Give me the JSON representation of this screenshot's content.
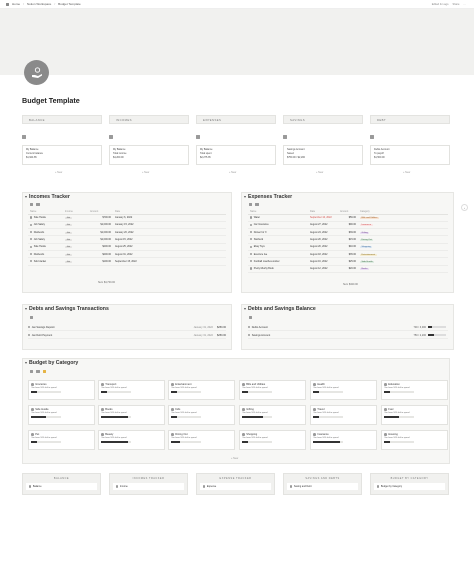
{
  "breadcrumb": [
    "Home",
    "Notion Workspace",
    "Budget Template"
  ],
  "topbar": {
    "edited": "Edited 4m ago",
    "share": "Share"
  },
  "page": {
    "title": "Budget Template"
  },
  "categories": [
    {
      "label": "BALANCE",
      "card": {
        "name": "My Balance",
        "line2": "Current balance",
        "line3": "$1,924.65"
      }
    },
    {
      "label": "INCOMES",
      "card": {
        "name": "My Balance",
        "line2": "Total income",
        "line3": "$4,200.00"
      }
    },
    {
      "label": "EXPENSES",
      "card": {
        "name": "My Balance",
        "line2": "Total spent",
        "line3": "$2,275.35"
      }
    },
    {
      "label": "SAVINGS",
      "card": {
        "name": "Savings Account",
        "line2": "Saved",
        "line3": "$750.00 / $2,200"
      }
    },
    {
      "label": "DEBT",
      "card": {
        "name": "Debts Account",
        "line2": "To payoff",
        "line3": "$1,500.00"
      }
    }
  ],
  "new_label": "+ New",
  "incomes": {
    "title": "Incomes Tracker",
    "headers": [
      "Name",
      "Income",
      "Amount",
      "Date"
    ],
    "rows": [
      {
        "name": "Side Hustle",
        "type": "Job",
        "amount": "$700.00",
        "date": "January 6, 2022"
      },
      {
        "name": "Job Salary",
        "type": "Job",
        "amount": "$1,000.00",
        "date": "January 15, 2022"
      },
      {
        "name": "Dividends",
        "type": "Job",
        "amount": "$1,000.00",
        "date": "January 20, 2022"
      },
      {
        "name": "Job Salary",
        "type": "Job",
        "amount": "$1,000.00",
        "date": "August 15, 2022"
      },
      {
        "name": "Side Hustle",
        "type": "Job",
        "amount": "$200.00",
        "date": "August 25, 2022"
      },
      {
        "name": "Dividends",
        "type": "Job",
        "amount": "$200.00",
        "date": "August 31, 2022"
      },
      {
        "name": "Sold Jacket",
        "type": "Job",
        "amount": "$100.00",
        "date": "September 15, 2022"
      }
    ],
    "sum": "Sum $4,700.00"
  },
  "expenses": {
    "title": "Expenses Tracker",
    "headers": [
      "Name",
      "Date",
      "Amount",
      "Category"
    ],
    "rows": [
      {
        "name": "Water",
        "date": "September 10, 2022",
        "amount": "$56.00",
        "category": "Bills and Utilities",
        "red": true
      },
      {
        "name": "Car Insurance",
        "date": "August 27, 2022",
        "amount": "$90.00",
        "category": "Insurance"
      },
      {
        "name": "Flower for X",
        "date": "August 24, 2022",
        "amount": "$39.00",
        "category": "Gifting"
      },
      {
        "name": "Starbuck",
        "date": "August 20, 2022",
        "amount": "$15.00",
        "category": "Dining Out"
      },
      {
        "name": "Ebay Toys",
        "date": "August 20, 2022",
        "amount": "$40.00",
        "category": "Shopping"
      },
      {
        "name": "Eventure fee",
        "date": "August 18, 2022",
        "amount": "$35.00",
        "category": "Entertainment"
      },
      {
        "name": "Football coaches worker",
        "date": "August 16, 2022",
        "amount": "$25.00",
        "category": "Side Hustle"
      },
      {
        "name": "Pretty Mushy Book",
        "date": "August 12, 2022",
        "amount": "$20.00",
        "category": "Books"
      }
    ],
    "sum": "Sum $320.00"
  },
  "debts_transactions": {
    "title": "Debts and Savings Transactions",
    "rows": [
      {
        "name": "Jan Savings Deposit",
        "date": "January 31, 2022",
        "amount": "$250.00"
      },
      {
        "name": "Jan Debt Payment",
        "date": "January 31, 2022",
        "amount": "$250.00"
      }
    ]
  },
  "debts_balance": {
    "title": "Debts and Savings Balance",
    "rows": [
      {
        "name": "Debts Account",
        "value": "700 / 3,000",
        "pct": 0.23
      },
      {
        "name": "Savings Account",
        "value": "750 / 2,200",
        "pct": 0.34
      }
    ]
  },
  "budget": {
    "title": "Budget by Category",
    "cards": [
      {
        "name": "Groceries",
        "sub": "You have 10% left to spend",
        "pct": 0.2
      },
      {
        "name": "Transport",
        "sub": "You have 10% left to spend",
        "pct": 0.2
      },
      {
        "name": "Entertainment",
        "sub": "You have 10% left to spend",
        "pct": 0.2
      },
      {
        "name": "Bills and Utilities",
        "sub": "You have 10% left to spend",
        "pct": 0.2
      },
      {
        "name": "Health",
        "sub": "You have 10% left to spend",
        "pct": 0.2
      },
      {
        "name": "Education",
        "sub": "You have 10% left to spend",
        "pct": 0.2
      },
      {
        "name": "Side Hustle",
        "sub": "You have 10% left to spend",
        "pct": 0.5
      },
      {
        "name": "Books",
        "sub": "You have 10% left to spend",
        "pct": 0.9
      },
      {
        "name": "Kids",
        "sub": "You have 10% left to spend",
        "pct": 0.2
      },
      {
        "name": "Gifting",
        "sub": "You have 10% left to spend",
        "pct": 0.7
      },
      {
        "name": "Travel",
        "sub": "You have 10% left to spend",
        "pct": 0.2
      },
      {
        "name": "Fuel",
        "sub": "You have 10% left to spend",
        "pct": 0.5
      },
      {
        "name": "Pet",
        "sub": "You have 10% left to spend",
        "pct": 0.2
      },
      {
        "name": "Beauty",
        "sub": "You have 10% left to spend",
        "pct": 0.9
      },
      {
        "name": "Dining Out",
        "sub": "You have 10% left to spend",
        "pct": 0.3
      },
      {
        "name": "Shopping",
        "sub": "You have 10% left to spend",
        "pct": 0.2
      },
      {
        "name": "Insurance",
        "sub": "You have 10% left to spend",
        "pct": 0.9
      },
      {
        "name": "Housing",
        "sub": "You have 10% left to spend",
        "pct": 0.2
      }
    ]
  },
  "nav": [
    {
      "head": "BALANCE",
      "link": "Balance"
    },
    {
      "head": "INCOMES TRACKER",
      "link": "Income"
    },
    {
      "head": "EXPENSE TRACKER",
      "link": "Expense"
    },
    {
      "head": "SAVINGS AND DEBTS",
      "link": "Saving and Debt"
    },
    {
      "head": "BUDGET BY CATEGORY",
      "link": "Budget by Category"
    }
  ]
}
